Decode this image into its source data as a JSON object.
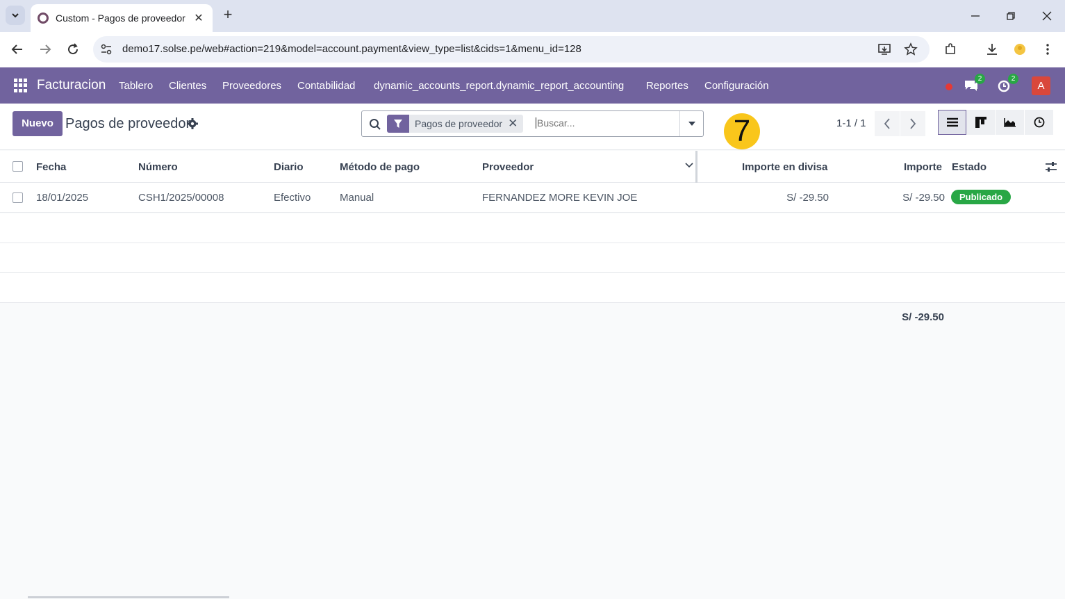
{
  "browser": {
    "tab_title": "Custom - Pagos de proveedor",
    "url": "demo17.solse.pe/web#action=219&model=account.payment&view_type=list&cids=1&menu_id=128"
  },
  "navbar": {
    "brand": "Facturacion",
    "menu": [
      "Tablero",
      "Clientes",
      "Proveedores",
      "Contabilidad",
      "dynamic_accounts_report.dynamic_report_accounting",
      "Reportes",
      "Configuración"
    ],
    "messages_count": "2",
    "activities_count": "2",
    "avatar_letter": "A",
    "color": "#71639e"
  },
  "control_panel": {
    "new_button": "Nuevo",
    "title": "Pagos de proveedor",
    "facet": "Pagos de proveedor",
    "search_placeholder": "Buscar...",
    "pager": "1-1 / 1",
    "step_marker": "7"
  },
  "table": {
    "headers": {
      "fecha": "Fecha",
      "numero": "Número",
      "diario": "Diario",
      "metodo": "Método de pago",
      "proveedor": "Proveedor",
      "importe_divisa": "Importe en divisa",
      "importe": "Importe",
      "estado": "Estado"
    },
    "rows": [
      {
        "fecha": "18/01/2025",
        "numero": "CSH1/2025/00008",
        "diario": "Efectivo",
        "metodo": "Manual",
        "proveedor": "FERNANDEZ MORE KEVIN JOE",
        "importe_divisa": "S/ -29.50",
        "importe": "S/ -29.50",
        "estado": "Publicado"
      }
    ],
    "total": "S/ -29.50",
    "status_color": "#28a745"
  }
}
